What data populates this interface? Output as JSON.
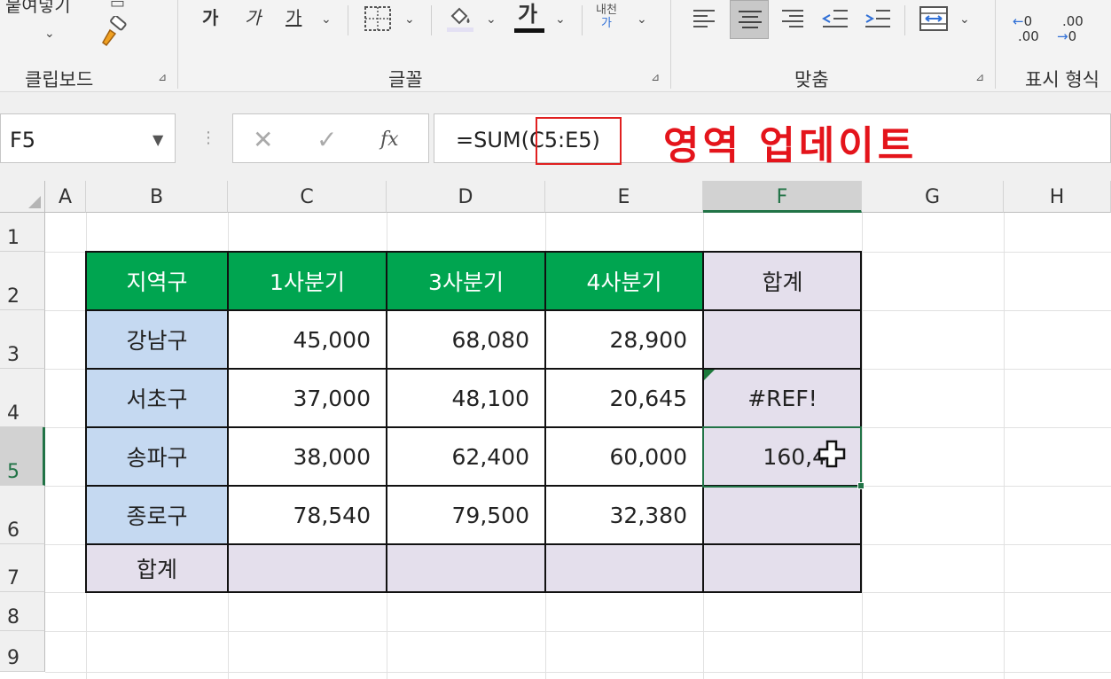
{
  "ribbon": {
    "paste_label": "붙여넣기",
    "groups": {
      "clipboard": "클립보드",
      "font": "글꼴",
      "alignment": "맞춤",
      "number": "표시 형식"
    },
    "font_buttons": {
      "bold": "가",
      "italic": "가",
      "underline": "가",
      "font_color_glyph": "가",
      "phonetic_top": "내천",
      "phonetic_bottom": "가"
    },
    "number_buttons": {
      "increase_decimal": ".00",
      "decrease_decimal": ".00"
    }
  },
  "formula_bar": {
    "name_box": "F5",
    "formula": "=SUM(C5:E5)",
    "fx": "fx",
    "annotation": "영역 업데이트"
  },
  "columns": [
    "A",
    "B",
    "C",
    "D",
    "E",
    "F",
    "G",
    "H"
  ],
  "rows": [
    "1",
    "2",
    "3",
    "4",
    "5",
    "6",
    "7",
    "8",
    "9"
  ],
  "table": {
    "headers": [
      "지역구",
      "1사분기",
      "3사분기",
      "4사분기",
      "합계"
    ],
    "rows": [
      {
        "name": "강남구",
        "q1": "45,000",
        "q3": "68,080",
        "q4": "28,900",
        "total": ""
      },
      {
        "name": "서초구",
        "q1": "37,000",
        "q3": "48,100",
        "q4": "20,645",
        "total": "#REF!"
      },
      {
        "name": "송파구",
        "q1": "38,000",
        "q3": "62,400",
        "q4": "60,000",
        "total": "160,4"
      },
      {
        "name": "종로구",
        "q1": "78,540",
        "q3": "79,500",
        "q4": "32,380",
        "total": ""
      }
    ],
    "total_label": "합계"
  },
  "colors": {
    "header_green": "#00a550",
    "name_blue": "#c5d9f1",
    "total_purple": "#e4dfec",
    "selection_green": "#217346",
    "annotation_red": "#e4141b"
  }
}
